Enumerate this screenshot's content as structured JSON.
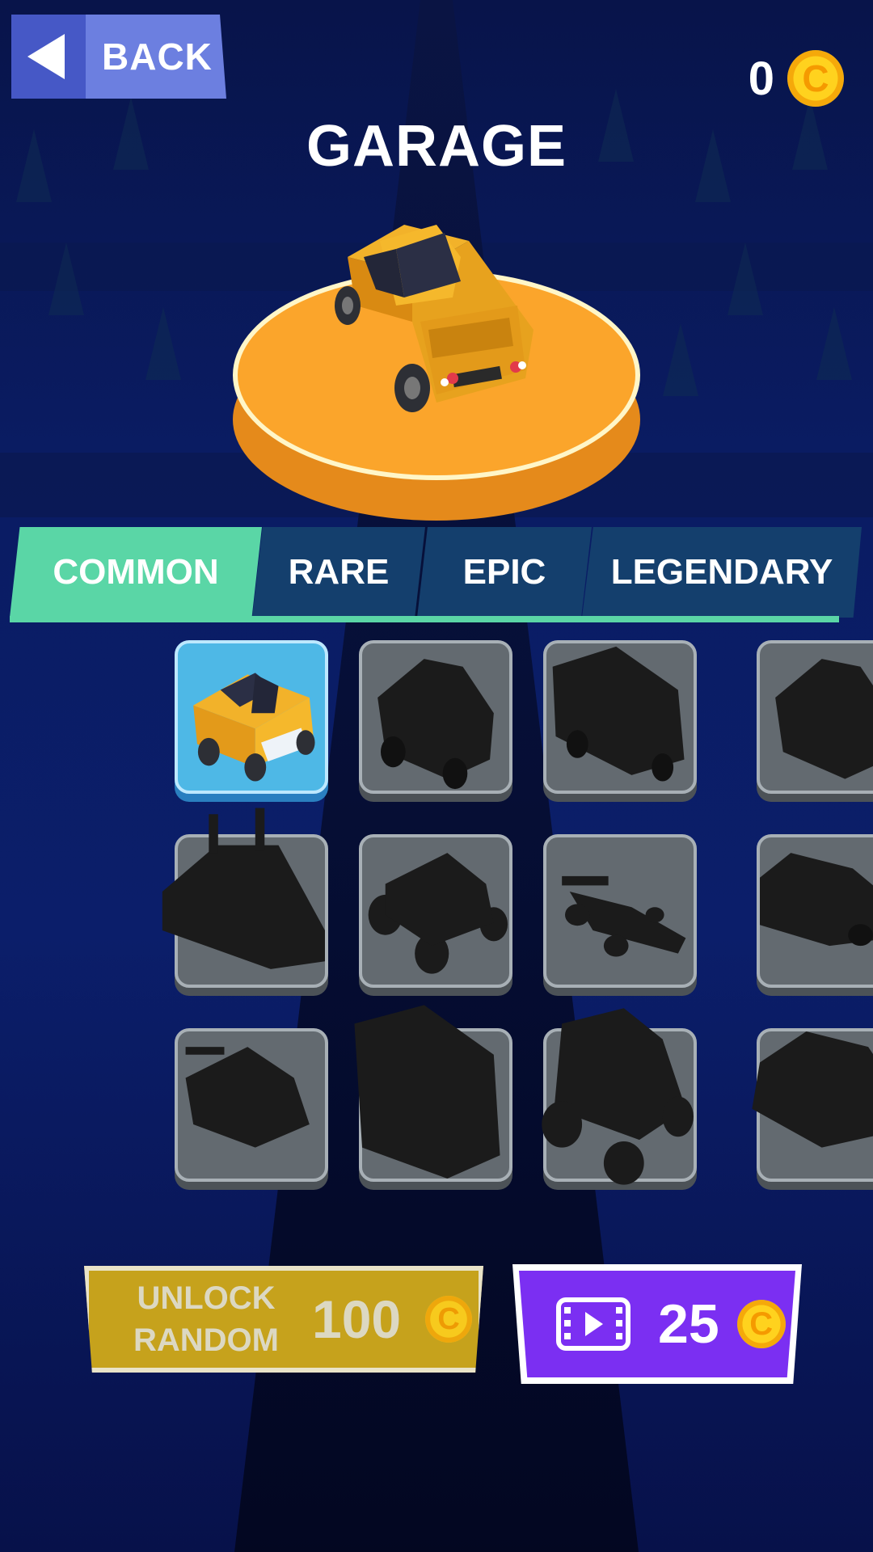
{
  "header": {
    "back_label": "BACK",
    "coins": "0",
    "coin_symbol": "C",
    "title": "GARAGE"
  },
  "tabs": [
    {
      "label": "COMMON",
      "active": true
    },
    {
      "label": "RARE",
      "active": false
    },
    {
      "label": "EPIC",
      "active": false
    },
    {
      "label": "LEGENDARY",
      "active": false
    }
  ],
  "garage_grid": {
    "selected_index": 0,
    "items": [
      {
        "kind": "pickup-truck",
        "unlocked": true
      },
      {
        "kind": "jeep",
        "unlocked": false
      },
      {
        "kind": "van",
        "unlocked": false
      },
      {
        "kind": "jeep",
        "unlocked": false
      },
      {
        "kind": "semi-truck",
        "unlocked": false
      },
      {
        "kind": "buggy",
        "unlocked": false
      },
      {
        "kind": "formula-car",
        "unlocked": false
      },
      {
        "kind": "sports-car",
        "unlocked": false
      },
      {
        "kind": "sports-car",
        "unlocked": false
      },
      {
        "kind": "box-truck",
        "unlocked": false
      },
      {
        "kind": "monster-truck",
        "unlocked": false
      },
      {
        "kind": "sports-car",
        "unlocked": false
      }
    ]
  },
  "actions": {
    "unlock_random_label": "UNLOCK RANDOM",
    "unlock_random_price": "100",
    "video_reward": "25"
  },
  "colors": {
    "background": "#0b1e6a",
    "tab_active": "#5ad6a6",
    "tab_inactive": "#143f6d",
    "back_button": "#6c7fe0",
    "unlock_button": "#c6a21c",
    "video_button": "#7b2ff2",
    "platform": "#fba52b",
    "coin": "#ffd21e"
  },
  "icons": [
    "back-arrow-icon",
    "coin-icon",
    "video-icon"
  ]
}
